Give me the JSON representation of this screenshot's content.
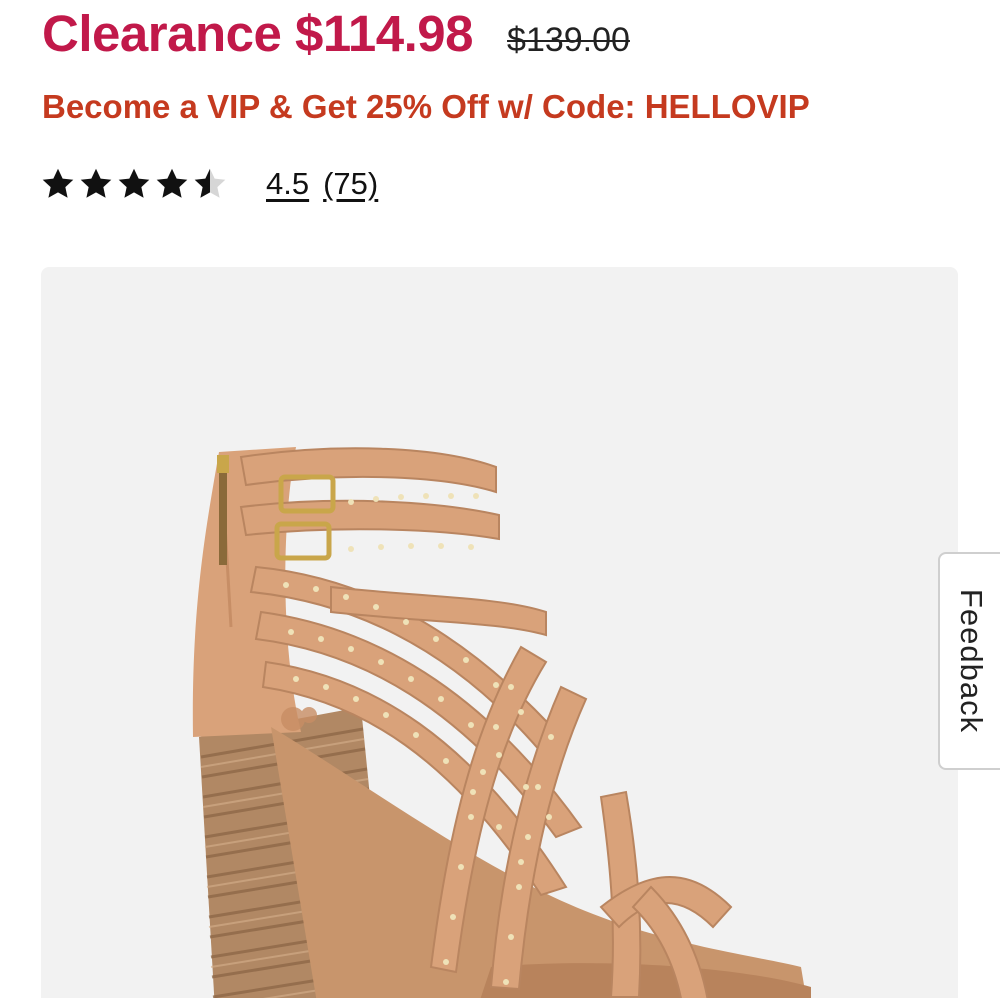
{
  "pricing": {
    "sale_label": "Clearance $114.98",
    "original_price": "$139.00"
  },
  "promo": {
    "text": "Become a VIP & Get 25% Off w/ Code: HELLOVIP"
  },
  "rating": {
    "stars_value": 4.5,
    "stars_max": 5,
    "score": "4.5",
    "count": "(75)"
  },
  "product_image": {
    "description_alt": "Strappy studded block-heel sandal",
    "color_strap": "#d9a27a",
    "color_heel": "#a9805c"
  },
  "feedback": {
    "label": "Feedback"
  },
  "colors": {
    "sale": "#c1194a",
    "promo": "#c53a1f",
    "panel_bg": "#f2f2f2"
  }
}
